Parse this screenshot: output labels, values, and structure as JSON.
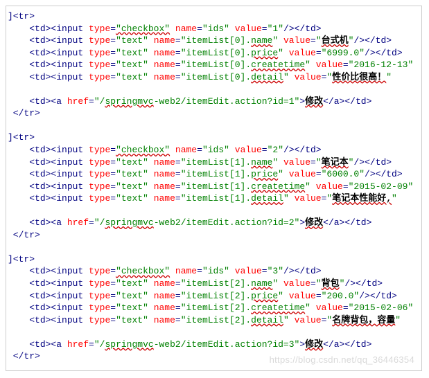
{
  "watermark": "https://blog.csdn.net/qq_36446354",
  "blocks": [
    {
      "open": "<tr>",
      "rows": [
        {
          "indent": "    ",
          "before": "<td><input ",
          "attrs": [
            [
              "type",
              "checkbox",
              true
            ],
            [
              "name",
              "ids",
              false
            ],
            [
              "value",
              "1",
              false
            ]
          ],
          "tail": "/></td>"
        },
        {
          "indent": "    ",
          "before": "<td><input ",
          "attrs": [
            [
              "type",
              "text",
              false
            ],
            [
              "name",
              "itemList[0].name",
              true
            ],
            [
              "value",
              "台式机",
              false,
              "cjk"
            ]
          ],
          "tail": "/></td>"
        },
        {
          "indent": "    ",
          "before": "<td><input ",
          "attrs": [
            [
              "type",
              "text",
              false
            ],
            [
              "name",
              "itemList[0].price",
              true
            ],
            [
              "value",
              "6999.0",
              false
            ]
          ],
          "tail": "/></td>"
        },
        {
          "indent": "    ",
          "before": "<td><input ",
          "attrs": [
            [
              "type",
              "text",
              false
            ],
            [
              "name",
              "itemList[0].createtime",
              true
            ],
            [
              "value",
              "2016-12-13",
              false
            ]
          ],
          "trunc": true
        },
        {
          "indent": "    ",
          "before": "<td><input ",
          "attrs": [
            [
              "type",
              "text",
              false
            ],
            [
              "name",
              "itemList[0].detail",
              true
            ],
            [
              "value",
              "性价比很高！",
              false,
              "cjk"
            ]
          ],
          "trunc": true,
          "tailClip": "\","
        }
      ],
      "linkIndent": "    ",
      "link": {
        "href": "/springmvc-web2/itemEdit.action?id=1",
        "text": "修改"
      },
      "close": "</tr>"
    },
    {
      "open": "<tr>",
      "rows": [
        {
          "indent": "    ",
          "before": "<td><input ",
          "attrs": [
            [
              "type",
              "checkbox",
              true
            ],
            [
              "name",
              "ids",
              false
            ],
            [
              "value",
              "2",
              false
            ]
          ],
          "tail": "/></td>"
        },
        {
          "indent": "    ",
          "before": "<td><input ",
          "attrs": [
            [
              "type",
              "text",
              false
            ],
            [
              "name",
              "itemList[1].name",
              true
            ],
            [
              "value",
              "笔记本",
              false,
              "cjk"
            ]
          ],
          "tail": "/></td>"
        },
        {
          "indent": "    ",
          "before": "<td><input ",
          "attrs": [
            [
              "type",
              "text",
              false
            ],
            [
              "name",
              "itemList[1].price",
              true
            ],
            [
              "value",
              "6000.0",
              false
            ]
          ],
          "tail": "/></td>"
        },
        {
          "indent": "    ",
          "before": "<td><input ",
          "attrs": [
            [
              "type",
              "text",
              false
            ],
            [
              "name",
              "itemList[1].createtime",
              true
            ],
            [
              "value",
              "2015-02-09",
              false
            ]
          ],
          "trunc": true
        },
        {
          "indent": "    ",
          "before": "<td><input ",
          "attrs": [
            [
              "type",
              "text",
              false
            ],
            [
              "name",
              "itemList[1].detail",
              true
            ],
            [
              "value",
              "笔记本性能好,",
              false,
              "cjk"
            ]
          ],
          "trunc": true
        }
      ],
      "linkIndent": "    ",
      "link": {
        "href": "/springmvc-web2/itemEdit.action?id=2",
        "text": "修改"
      },
      "close": "</tr>"
    },
    {
      "open": "<tr>",
      "rows": [
        {
          "indent": "    ",
          "before": "<td><input ",
          "attrs": [
            [
              "type",
              "checkbox",
              true
            ],
            [
              "name",
              "ids",
              false
            ],
            [
              "value",
              "3",
              false
            ]
          ],
          "tail": "/></td>"
        },
        {
          "indent": "    ",
          "before": "<td><input ",
          "attrs": [
            [
              "type",
              "text",
              false
            ],
            [
              "name",
              "itemList[2].name",
              true
            ],
            [
              "value",
              "背包",
              false,
              "cjk"
            ]
          ],
          "tail": "/></td>"
        },
        {
          "indent": "    ",
          "before": "<td><input ",
          "attrs": [
            [
              "type",
              "text",
              false
            ],
            [
              "name",
              "itemList[2].price",
              true
            ],
            [
              "value",
              "200.0",
              false
            ]
          ],
          "tail": "/></td>"
        },
        {
          "indent": "    ",
          "before": "<td><input ",
          "attrs": [
            [
              "type",
              "text",
              false
            ],
            [
              "name",
              "itemList[2].createtime",
              true
            ],
            [
              "value",
              "2015-02-06",
              false
            ]
          ],
          "trunc": true
        },
        {
          "indent": "    ",
          "before": "<td><input ",
          "attrs": [
            [
              "type",
              "text",
              false
            ],
            [
              "name",
              "itemList[2].detail",
              true
            ],
            [
              "value",
              "名牌背包，容量",
              false,
              "cjk"
            ]
          ],
          "trunc": true
        }
      ],
      "linkIndent": "    ",
      "link": {
        "href": "/springmvc-web2/itemEdit.action?id=3",
        "text": "修改"
      },
      "close": "</tr>"
    }
  ]
}
